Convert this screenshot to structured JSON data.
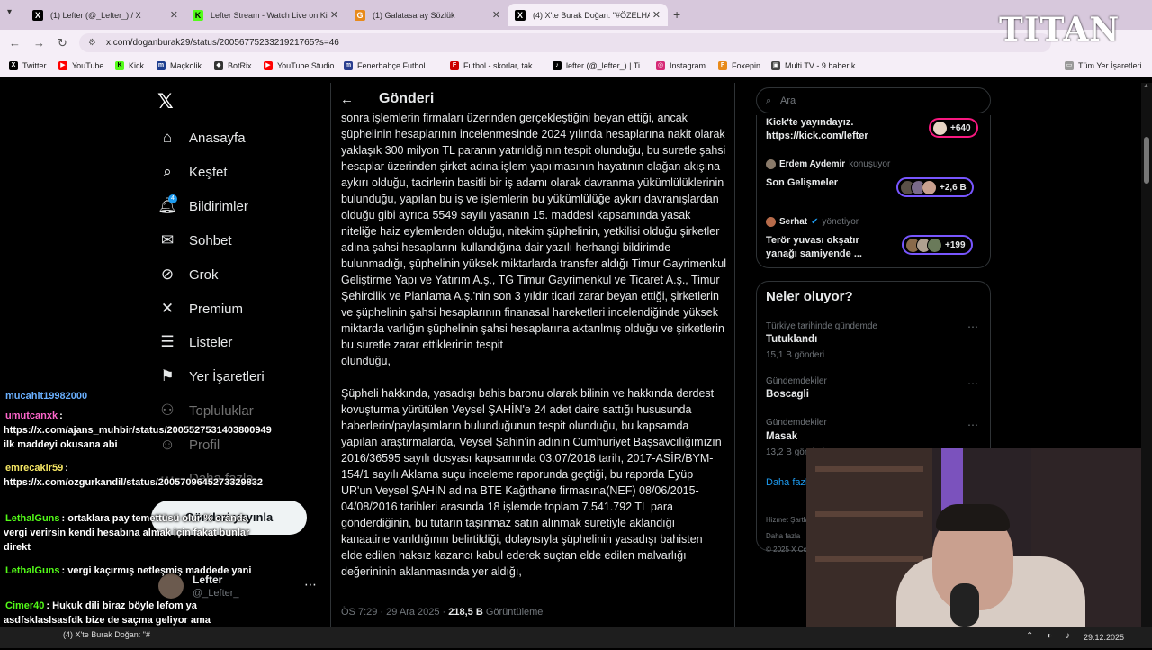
{
  "browser": {
    "tabs": [
      {
        "title": "(1) Lefter (@_Lefter_) / X",
        "favicon": "X"
      },
      {
        "title": "Lefter Stream - Watch Live on Kick",
        "favicon": "K"
      },
      {
        "title": "(1) Galatasaray Sözlük",
        "favicon": "G"
      },
      {
        "title": "(4) X'te Burak Doğan: \"#ÖZELHABER",
        "favicon": "X"
      }
    ],
    "url": "x.com/doganburak29/status/2005677523321921765?s=46",
    "bookmarks": [
      "Twitter",
      "YouTube",
      "Kick",
      "Maçkolik",
      "BotRix",
      "YouTube Studio",
      "Fenerbahçe Futbol...",
      "Futbol - skorlar, tak...",
      "lefter (@_lefter_) | Ti...",
      "Instagram",
      "Foxepin",
      "Multi TV - 9 haber k..."
    ],
    "all_bookmarks": "Tüm Yer İşaretleri"
  },
  "overlay_logo": "TITAN",
  "nav": {
    "items": [
      "Anasayfa",
      "Keşfet",
      "Bildirimler",
      "Sohbet",
      "Grok",
      "Premium",
      "Listeler",
      "Yer İşaretleri",
      "Topluluklar",
      "Profil",
      "Daha fazla"
    ],
    "notif_count": "4",
    "post_button": "Gönderi yayınla"
  },
  "profile": {
    "name": "Lefter",
    "handle": "@_Lefter_"
  },
  "post": {
    "header": "Gönderi",
    "body": "sonra işlemlerin firmaları üzerinden gerçekleştiğini beyan ettiği, ancak şüphelinin hesaplarının incelenmesinde 2024 yılında hesaplarına nakit olarak yaklaşık 300 milyon TL paranın yatırıldığının tespit olunduğu, bu suretle şahsi hesaplar üzerinden şirket adına işlem yapılmasının hayatının olağan akışına aykırı olduğu, tacirlerin basitli bir iş adamı olarak davranma yükümlülüklerinin bulunduğu, yapılan bu iş ve işlemlerin bu yükümlülüğe aykırı davranışlardan olduğu gibi ayrıca 5549 sayılı yasanın 15. maddesi kapsamında yasak niteliğe haiz eylemlerden olduğu, nitekim şüphelinin, yetkilisi olduğu şirketler adına şahsi hesaplarını kullandığına dair yazılı herhangi bildirimde bulunmadığı, şüphelinin yüksek miktarlarda transfer aldığı Timur Gayrimenkul Geliştirme Yapı ve Yatırım A.ş., TG Timur Gayrimenkul ve Ticaret A.ş., Timur Şehircilik ve Planlama A.ş.'nin son 3 yıldır ticari zarar beyan ettiği, şirketlerin ve şüphelinin şahsi hesaplarının finanasal hareketleri incelendiğinde yüksek miktarda varlığın şüphelinin şahsi hesaplarına aktarılmış olduğu ve şirketlerin bu suretle zarar ettikleri­nin tespit\nolunduğu,\n\nŞüpheli hakkında, yasadışı bahis baronu olarak bilinin ve hakkında derdest kovuşturma yürütülen Veysel ŞAHİN'e 24 adet daire sattığı hususunda haberlerin/paylaşımların bulunduğunun tespit olunduğu, bu kapsamda yapılan araştırmalarda, Veysel Şahin'in adının Cumhuriyet Başsavcılığımızın 2016/36595 sayılı dosyası kapsamında 03.07/2018 tarih, 2017-ASİR/BYM-154/1 sayılı Aklama suçu inceleme raporunda geçtiği, bu raporda Eyüp UR'un Veysel ŞAHİN adına BTE Kağıthane firmasına(NEF) 08/06/2015-04/08/2016 tarihleri arasında 18 işlemde toplam 7.541.792 TL para gönderdiğinin, bu tutarın taşınmaz satın alınmak suretiyle aklandığı kanaatine varıldığının belirtildiği, dolayısıyla şüphelinin yasadışı bahisten elde edilen haksız kazancı kabul ederek suçtan elde edilen malvarlığı değerininin aklanmasında yer aldığı,",
    "time": "ÖS 7:29 · 29 Ara 2025 · ",
    "views": "218,5 B",
    "views_label": " Görüntüleme"
  },
  "sidebar": {
    "search_placeholder": "Ara",
    "lives": [
      {
        "host": "",
        "role": "",
        "title": "Kick'te yayındayız. https://kick.com/lefter",
        "count": "+640"
      },
      {
        "host": "Erdem Aydemir",
        "role": "konuşuyor",
        "title": "Son Gelişmeler",
        "count": "+2,6 B"
      },
      {
        "host": "Serhat",
        "role": "yönetiyor",
        "title": "Terör yuvası okşatır yanağı samiyende ...",
        "count": "+199"
      }
    ],
    "trends_title": "Neler oluyor?",
    "trends": [
      {
        "context": "Türkiye tarihinde gündemde",
        "name": "Tutuklandı",
        "count": "15,1 B gönderi"
      },
      {
        "context": "Gündemdekiler",
        "name": "Boscagli",
        "count": ""
      },
      {
        "context": "Gündemdekiler",
        "name": "Masak",
        "count": "13,2 B gönderi"
      }
    ],
    "show_more": "Daha fazla",
    "footer": [
      "Hizmet Şartları",
      "Daha fazla",
      "© 2025 X Corp."
    ]
  },
  "chat": [
    {
      "user": "mucahit19982000",
      "msg": ""
    },
    {
      "user": "umutcanxk",
      "msg": ": https://x.com/ajans_muhbir/status/2005527531403800949 ilk maddeyi okusana abi"
    },
    {
      "user": "emrecakir59",
      "msg": ": https://x.com/ozgurkandil/status/2005709645273329832"
    },
    {
      "user": "LethalGuns",
      "msg": ": ortaklara pay temettüsü olur % oranda vergi verirsin kendi hesabına almak için fakat bunlar direkt"
    },
    {
      "user": "LethalGuns",
      "msg": ": vergi kaçırmış netleşmiş maddede yani"
    },
    {
      "user": "Cimer40",
      "msg": ": Hukuk dili biraz böyle lefom ya asdfsklaslsasfdk bize de saçma geliyor ama konuşması güzel"
    }
  ],
  "taskbar": {
    "window": "(4) X'te Burak Doğan: \"#",
    "date": "29.12.2025"
  },
  "colors": {
    "accent": "#1d9bf0",
    "live_pink": "#f91880",
    "live_purple": "#7856ff",
    "chat_user_yellow": "#f5e663",
    "chat_user_green": "#53fc18",
    "chat_user_pink": "#ff66cc"
  }
}
